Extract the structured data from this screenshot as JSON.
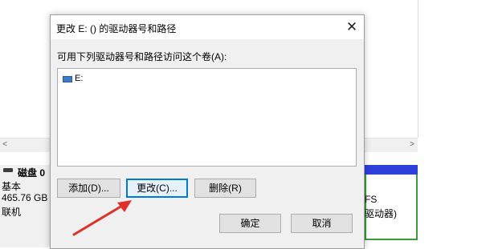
{
  "dialog": {
    "title": "更改 E: () 的驱动器号和路径",
    "close_glyph": "✕",
    "list_label": "可用下列驱动器号和路径访问这个卷(A):",
    "list_items": [
      {
        "label": "E:"
      }
    ],
    "buttons": {
      "add": "添加(D)...",
      "change": "更改(C)...",
      "remove": "删除(R)",
      "ok": "确定",
      "cancel": "取消"
    }
  },
  "background": {
    "scroll_left_glyph": "<",
    "scroll_right_glyph": ">",
    "disk": {
      "name": "磁盘 0",
      "type": "基本",
      "size": "465.76 GB",
      "status": "联机"
    },
    "partition": {
      "fs_fragment": "FS",
      "desc_fragment": "驱动器)"
    }
  },
  "colors": {
    "accent": "#0078d7",
    "partition_bar": "#2c3fd9",
    "partition_border": "#3a9c3a",
    "annotation_arrow": "#e0302a"
  }
}
